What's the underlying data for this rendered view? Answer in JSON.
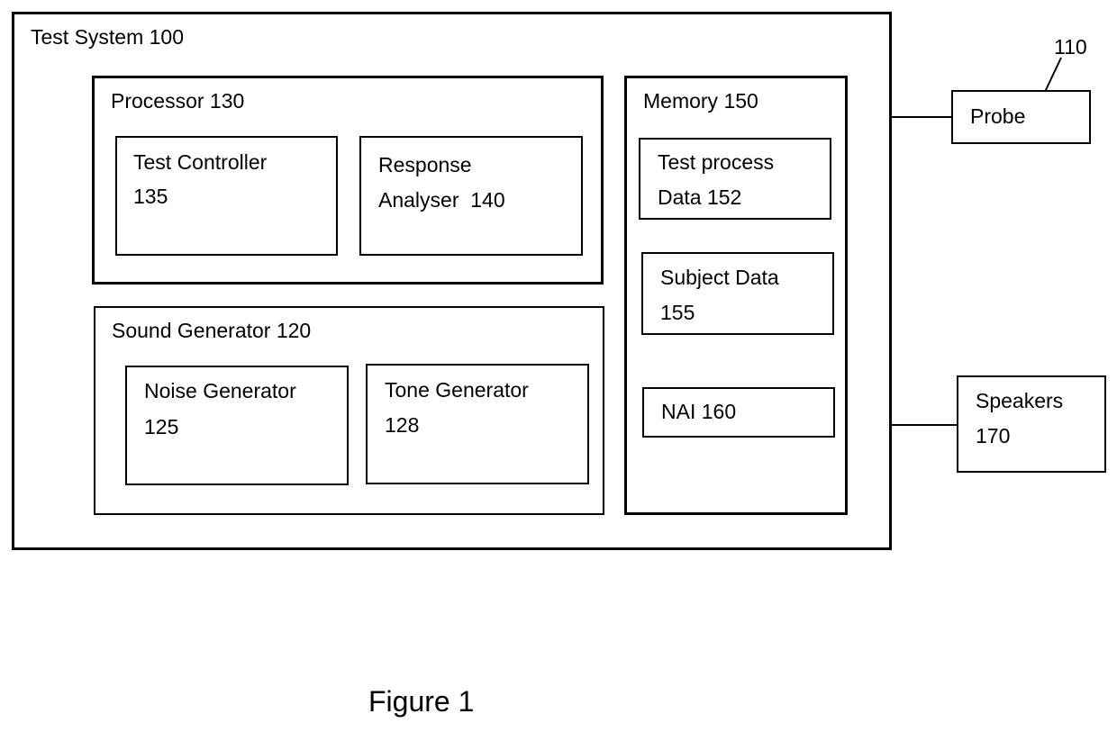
{
  "diagram": {
    "test_system": {
      "label": "Test System 100"
    },
    "processor": {
      "label": "Processor 130",
      "test_controller": {
        "line1": "Test Controller",
        "line2": "135"
      },
      "response_analyser": {
        "line1": "Response",
        "line2": "Analyser  140"
      }
    },
    "sound_generator": {
      "label": "Sound Generator 120",
      "noise_generator": {
        "line1": "Noise Generator",
        "line2": "125"
      },
      "tone_generator": {
        "line1": "Tone Generator",
        "line2": "128"
      }
    },
    "memory": {
      "label": "Memory 150",
      "test_process_data": {
        "line1": "Test process",
        "line2": "Data 152"
      },
      "subject_data": {
        "line1": "Subject Data",
        "line2": "155"
      },
      "nai": {
        "label": "NAI 160"
      }
    },
    "probe": {
      "label": "Probe",
      "ref": "110"
    },
    "speakers": {
      "line1": "Speakers",
      "line2": "170"
    },
    "caption": "Figure 1"
  }
}
